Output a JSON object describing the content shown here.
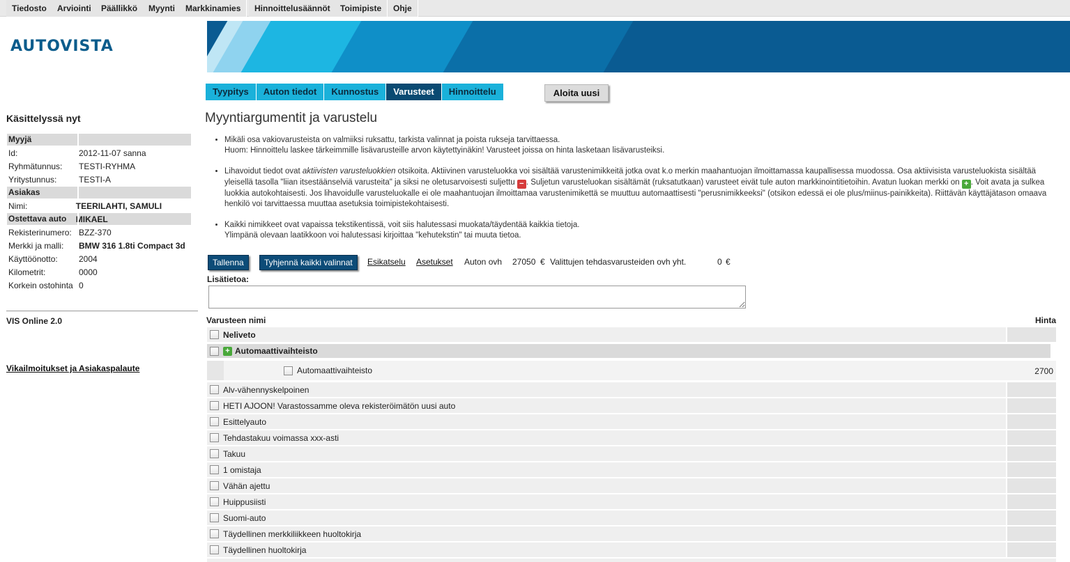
{
  "menu": [
    "Tiedosto",
    "Arviointi",
    "Päällikkö",
    "Myynti",
    "Markkinamies",
    "Hinnoittelusäännöt",
    "Toimipiste",
    "Ohje"
  ],
  "brand": {
    "logo": "AUTOVISTA",
    "colors": {
      "primary": "#0b5c8c",
      "accent": "#1ab1da",
      "active_tab": "#0a4a72"
    }
  },
  "tabs": [
    {
      "label": "Tyypitys",
      "active": false
    },
    {
      "label": "Auton tiedot",
      "active": false
    },
    {
      "label": "Kunnostus",
      "active": false
    },
    {
      "label": "Varusteet",
      "active": true
    },
    {
      "label": "Hinnoittelu",
      "active": false
    }
  ],
  "start_new_label": "Aloita uusi",
  "sidebar": {
    "heading": "Käsittelyssä nyt",
    "sections": [
      {
        "title": "Myyjä",
        "rows": [
          {
            "key": "Id:",
            "value": "2012-11-07  sanna",
            "bold": false
          },
          {
            "key": "Ryhmätunnus:",
            "value": "TESTI-RYHMA",
            "bold": false
          },
          {
            "key": "Yritystunnus:",
            "value": "TESTI-A",
            "bold": false
          }
        ]
      },
      {
        "title": "Asiakas",
        "rows": [
          {
            "key": "Nimi:",
            "value": "TEERILAHTI, SAMULI MIKAEL",
            "bold": true
          }
        ]
      },
      {
        "title": "Ostettava auto",
        "rows": [
          {
            "key": "Rekisterinumero:",
            "value": "BZZ-370",
            "bold": false
          },
          {
            "key": "Merkki ja malli:",
            "value": "BMW 316 1.8ti Compact 3d",
            "bold": true
          },
          {
            "key": "Käyttöönotto:",
            "value": "2004",
            "bold": false
          },
          {
            "key": "Kilometrit:",
            "value": "0000",
            "bold": false
          },
          {
            "key": "Korkein ostohinta",
            "value": "0",
            "bold": false
          }
        ]
      }
    ],
    "version": "VIS Online 2.0",
    "feedback_link": "Vikailmoitukset ja Asiakaspalaute"
  },
  "main": {
    "title": "Myyntiargumentit ja varustelu",
    "bullet1_line1": "Mikäli osa vakiovarusteista on valmiiksi ruksattu, tarkista valinnat ja poista rukseja tarvittaessa.",
    "bullet1_line2": "Huom: Hinnoittelu laskee tärkeimmille lisävarusteille arvon käytettyinäkin! Varusteet joissa on hinta lasketaan lisävarusteiksi.",
    "bullet2_a": "Lihavoidut tiedot ovat ",
    "bullet2_em": "aktiivisten varusteluokkien",
    "bullet2_b": " otsikoita. Aktiivinen varusteluokka voi sisältää varustenimikkeitä jotka ovat k.o merkin maahantuojan ilmoittamassa kaupallisessa muodossa. Osa aktiivisista varusteluokista sisältää yleisellä tasolla \"liian itsestäänselviä varusteita\" ja siksi ne oletusarvoisesti suljettu ",
    "bullet2_c": ". Suljetun varusteluokan sisältämät (ruksatutkaan) varusteet eivät tule auton markkinointitietoihin. Avatun luokan merkki on ",
    "bullet2_d": ". Voit avata ja sulkea luokkia autokohtaisesti. Jos lihavoidulle varusteluokalle ei ole maahantuojan ilmoittamaa varustenimikettä se muuttuu automaattisesti \"perusnimikkeeksi\" (otsikon edessä ei ole plus/miinus-painikkeita). Riittävän käyttäjätason omaava henkilö voi tarvittaessa muuttaa asetuksia toimipistekohtaisesti.",
    "bullet3_line1": "Kaikki nimikkeet ovat vapaissa tekstikentissä, voit siis halutessasi muokata/täydentää kaikkia tietoja.",
    "bullet3_line2": "Ylimpänä olevaan laatikkoon voi halutessasi kirjoittaa \"kehutekstin\" tai muuta tietoa."
  },
  "toolbar": {
    "save": "Tallenna",
    "clear": "Tyhjennä kaikki valinnat",
    "preview": "Esikatselu",
    "settings": "Asetukset",
    "car_price_label": "Auton ovh",
    "car_price": "27050",
    "currency": "€",
    "selected_label": "Valittujen tehdasvarusteiden ovh yht.",
    "selected_total": "0"
  },
  "extra_info_label": "Lisätietoa:",
  "equipment": {
    "col_name": "Varusteen nimi",
    "col_price": "Hinta",
    "first_item": "Neliveto",
    "group": {
      "name": "Automaattivaihteisto",
      "state": "open",
      "sub_item": "Automaattivaihteisto",
      "sub_price": "2700"
    },
    "items": [
      "Alv-vähennyskelpoinen",
      "HETI AJOON! Varastossamme oleva rekisteröimätön uusi auto",
      "Esittelyauto",
      "Tehdastakuu voimassa xxx-asti",
      "Takuu",
      "1 omistaja",
      "Vähän ajettu",
      "Huippusiisti",
      "Suomi-auto",
      "Täydellinen merkkiliikkeen huoltokirja",
      "Täydellinen huoltokirja"
    ]
  }
}
